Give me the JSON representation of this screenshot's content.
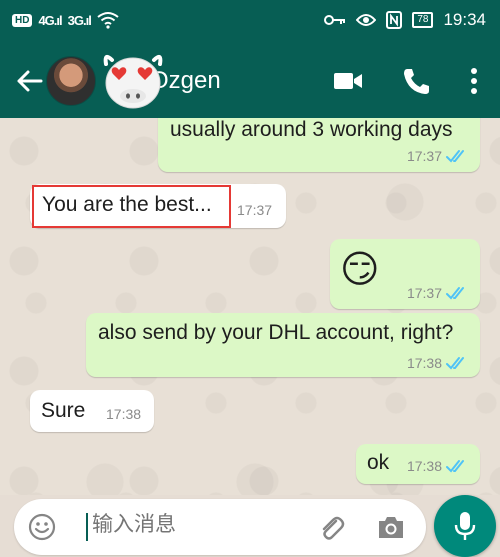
{
  "status_bar": {
    "hd_badge": "HD",
    "network_1": "4G",
    "network_2": "3G",
    "battery": "78",
    "time": "19:34"
  },
  "header": {
    "contact_name": "Ozgen",
    "icons": [
      "back-arrow-icon",
      "video-call-icon",
      "phone-icon",
      "more-vert-icon"
    ]
  },
  "messages": [
    {
      "direction": "out",
      "text": "usually around 3 working days",
      "time": "17:37",
      "read": true
    },
    {
      "direction": "in",
      "text": "You are the best...",
      "time": "17:37",
      "highlighted": true
    },
    {
      "direction": "out",
      "text": "😏",
      "time": "17:37",
      "read": true
    },
    {
      "direction": "out",
      "text": "also send by your DHL account, right?",
      "time": "17:38",
      "read": true
    },
    {
      "direction": "in",
      "text": "Sure",
      "time": "17:38"
    },
    {
      "direction": "out",
      "text": "ok",
      "time": "17:38",
      "read": true
    }
  ],
  "composer": {
    "placeholder": "输入消息"
  },
  "colors": {
    "header": "#075e54",
    "outgoing_bubble": "#dcf8c6",
    "incoming_bubble": "#ffffff",
    "read_ticks": "#4fc3f7",
    "mic_button": "#00897b",
    "highlight_box": "#e53935"
  }
}
